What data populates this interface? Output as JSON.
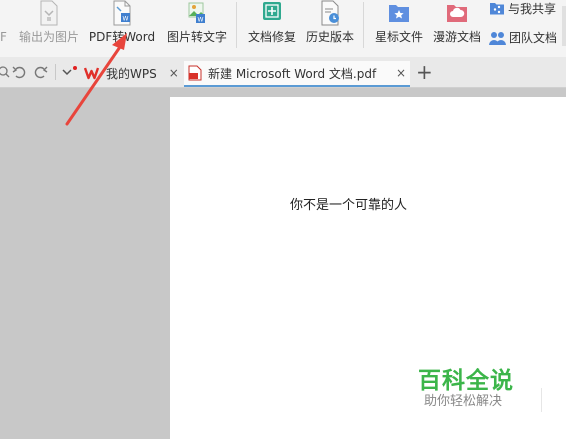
{
  "ribbon": {
    "partial_left": "F",
    "export_image": "输出为图片",
    "pdf_to_word": "PDF转Word",
    "image_to_text": "图片转文字",
    "doc_repair": "文档修复",
    "history": "历史版本",
    "starred": "星标文件",
    "roaming": "漫游文档",
    "shared_with_me": "与我共享",
    "team_docs": "团队文档"
  },
  "tabs": {
    "my_wps": "我的WPS",
    "doc_tab": "新建 Microsoft Word 文档.pdf",
    "close": "×",
    "add": "+"
  },
  "document": {
    "text": "你不是一个可靠的人"
  },
  "watermark": {
    "title": "百科全说",
    "subtitle": "助你轻松解决"
  },
  "colors": {
    "annotation_arrow": "#e8453c",
    "active_tab_underline": "#5b9bd5",
    "watermark_green": "#3cb54a"
  }
}
